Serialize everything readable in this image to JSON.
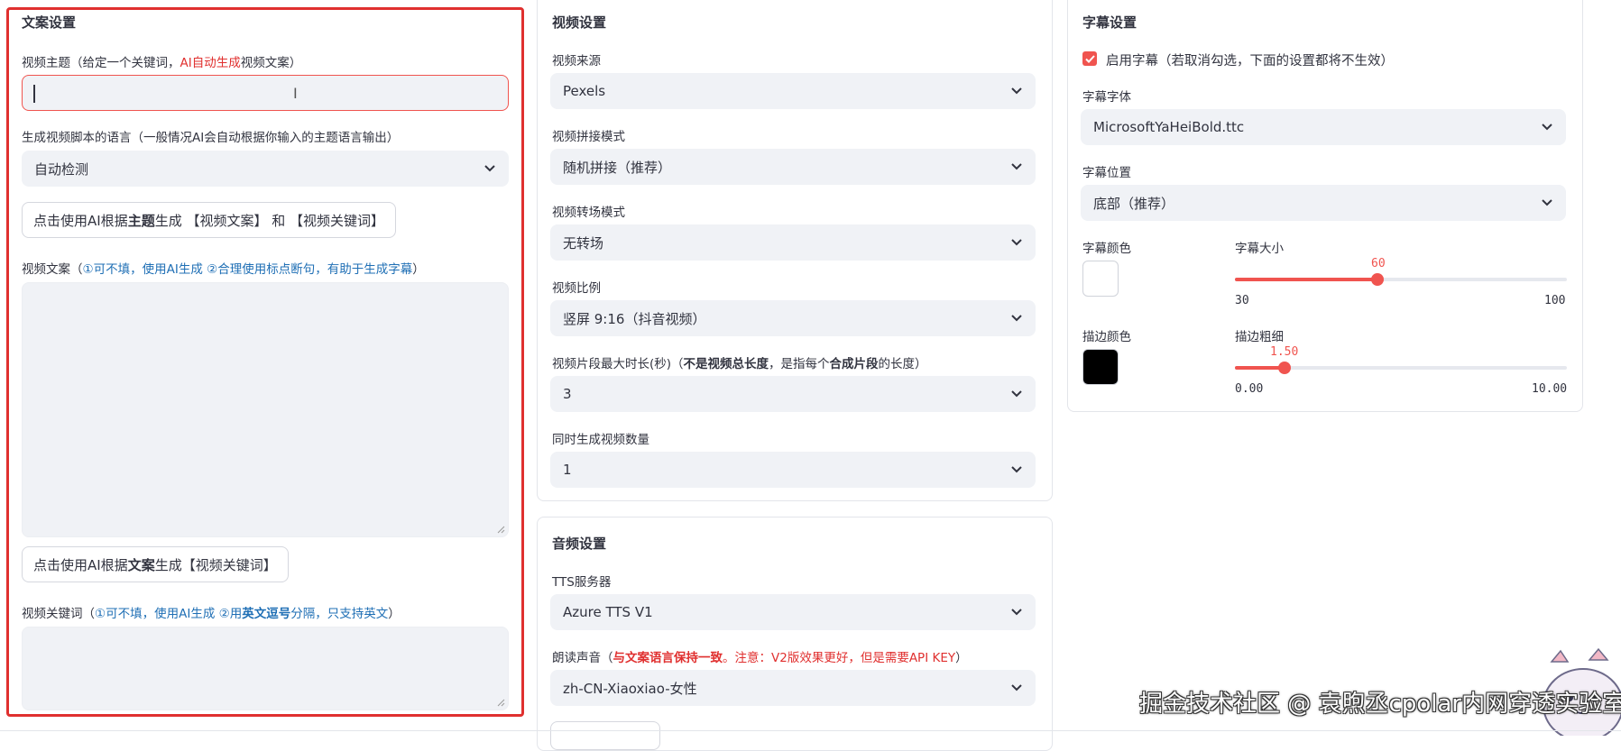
{
  "copy_panel": {
    "title": "文案设置",
    "topic_label_pre": "视频主题（给定一个关键词，",
    "topic_label_red": "AI自动生成",
    "topic_label_post": "视频文案）",
    "topic_value": "",
    "lang_label": "生成视频脚本的语言（一般情况AI会自动根据你输入的主题语言输出）",
    "lang_value": "自动检测",
    "gen_script_btn_pre": "点击使用AI根据",
    "gen_script_btn_bold": "主题",
    "gen_script_btn_post": "生成 【视频文案】 和 【视频关键词】",
    "script_label_pre": "视频文案（",
    "script_label_blue": "①可不填，使用AI生成 ②合理使用标点断句，有助于生成字幕",
    "script_label_post": "）",
    "script_value": "",
    "gen_kw_btn_pre": "点击使用AI根据",
    "gen_kw_btn_bold": "文案",
    "gen_kw_btn_post": "生成【视频关键词】",
    "kw_label_pre": "视频关键词（",
    "kw_label_blue1": "①可不填，使用AI生成 ②用",
    "kw_label_bold": "英文逗号",
    "kw_label_blue2": "分隔，只支持英文",
    "kw_label_post": "）",
    "kw_value": ""
  },
  "video_panel": {
    "title": "视频设置",
    "source_label": "视频来源",
    "source_value": "Pexels",
    "concat_label": "视频拼接模式",
    "concat_value": "随机拼接（推荐）",
    "transition_label": "视频转场模式",
    "transition_value": "无转场",
    "ratio_label": "视频比例",
    "ratio_value": "竖屏 9:16（抖音视频）",
    "clip_label_pre": "视频片段最大时长(秒)（",
    "clip_label_bold1": "不是视频总长度",
    "clip_label_mid": "，是指每个",
    "clip_label_bold2": "合成片段",
    "clip_label_post": "的长度）",
    "clip_value": "3",
    "count_label": "同时生成视频数量",
    "count_value": "1"
  },
  "audio_panel": {
    "title": "音频设置",
    "tts_label": "TTS服务器",
    "tts_value": "Azure TTS V1",
    "voice_label_pre": "朗读声音（",
    "voice_label_red_bold": "与文案语言保持一致",
    "voice_label_red": "。注意：V2版效果更好，但是需要API KEY",
    "voice_label_post": "）",
    "voice_value": "zh-CN-Xiaoxiao-女性"
  },
  "subtitle_panel": {
    "title": "字幕设置",
    "enable_label": "启用字幕（若取消勾选，下面的设置都将不生效）",
    "enable_checked": true,
    "font_label": "字幕字体",
    "font_value": "MicrosoftYaHeiBold.ttc",
    "position_label": "字幕位置",
    "position_value": "底部（推荐）",
    "color_label": "字幕颜色",
    "color_value": "#ffffff",
    "size_label": "字幕大小",
    "size_value": "60",
    "size_min": "30",
    "size_max": "100",
    "stroke_color_label": "描边颜色",
    "stroke_color_value": "#000000",
    "stroke_width_label": "描边粗细",
    "stroke_width_value": "1.50",
    "stroke_width_min": "0.00",
    "stroke_width_max": "10.00"
  },
  "watermark": "掘金技术社区 @ 袁煦丞cpolar内网穿透实验室",
  "colors": {
    "accent": "#f0544f",
    "highlight_frame": "#e0302f",
    "hint_blue": "#1f6fb5"
  }
}
